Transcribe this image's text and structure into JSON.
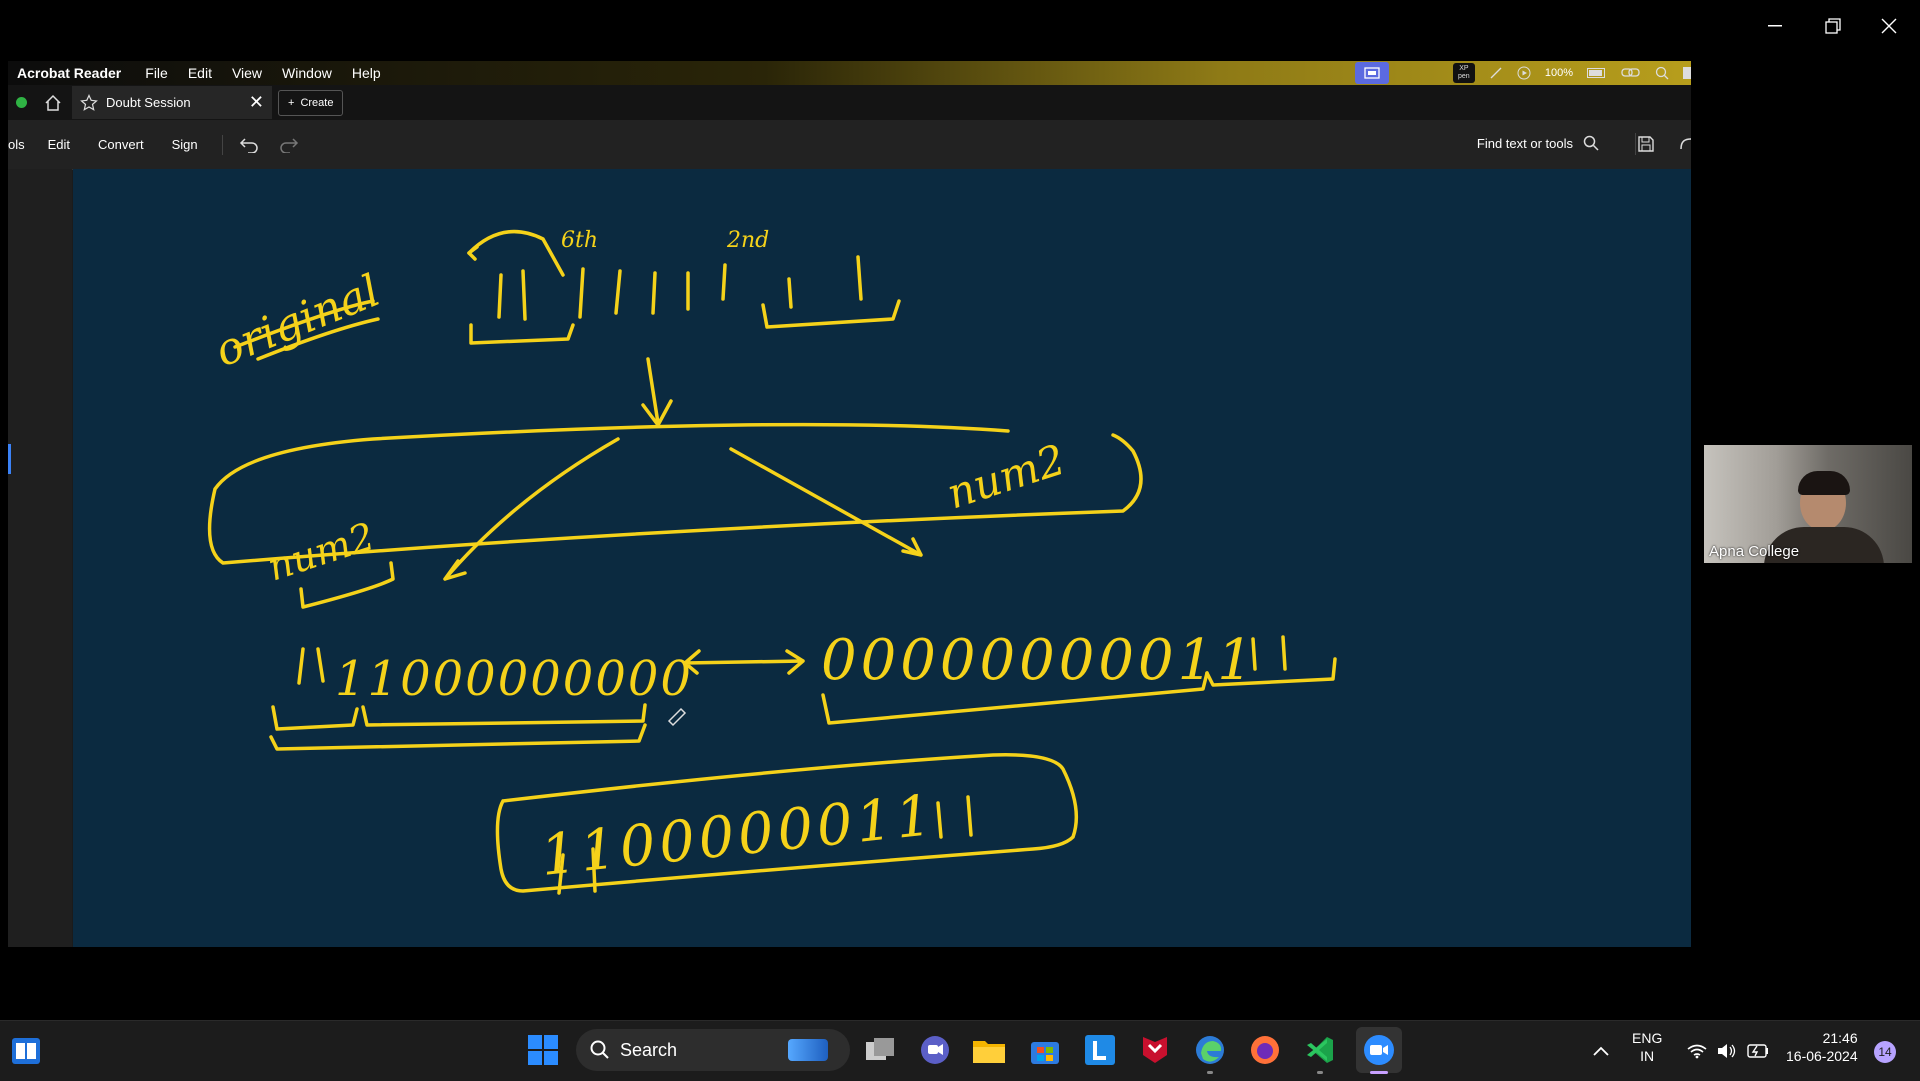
{
  "app": {
    "brand": "Acrobat Reader",
    "menu": [
      "File",
      "Edit",
      "View",
      "Window",
      "Help"
    ],
    "status_right": "100%"
  },
  "tabs": {
    "active_tab_label": "Doubt Session",
    "create_label": "Create"
  },
  "toolbar": {
    "items": [
      "ols",
      "Edit",
      "Convert",
      "Sign"
    ],
    "find_label": "Find text or tools"
  },
  "handwriting": {
    "word_original": "original",
    "ordinal_6": "6th",
    "ordinal_2": "2nd",
    "binary_top": "1 1 | 1 1 1 1 1 | 1 1",
    "num2_left": "num2",
    "num2_right": "num2",
    "binary_left": "11000000000",
    "binary_right": "00000000011",
    "result": "1100000011"
  },
  "camera": {
    "participant_name": "Apna College"
  },
  "taskbar": {
    "search_label": "Search",
    "lang_line1": "ENG",
    "lang_line2": "IN",
    "time": "21:46",
    "date": "16-06-2024",
    "notification_count": "14"
  },
  "colors": {
    "ink": "#f5d21a",
    "canvas_bg": "#0b2a40"
  }
}
